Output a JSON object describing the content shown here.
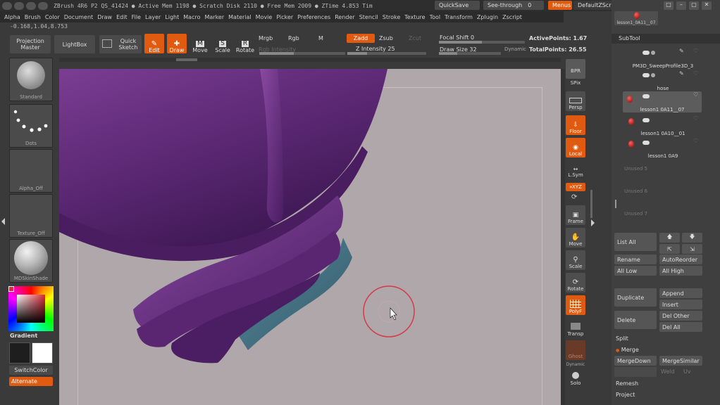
{
  "titlebar": {
    "text": "ZBrush 4R6 P2    QS_41424    ● Active Mem 1198  ● Scratch Disk 2110  ● Free Mem 2009  ● ZTime 4.853 Tim",
    "quicksave": "QuickSave",
    "seethrough_label": "See-through",
    "seethrough_value": "0",
    "menus": "Menus",
    "script": "DefaultZScript"
  },
  "menubar": [
    "Alpha",
    "Brush",
    "Color",
    "Document",
    "Draw",
    "Edit",
    "File",
    "Layer",
    "Light",
    "Macro",
    "Marker",
    "Material",
    "Movie",
    "Picker",
    "Preferences",
    "Render",
    "Stencil",
    "Stroke",
    "Texture",
    "Tool",
    "Transform",
    "Zplugin",
    "Zscript"
  ],
  "coords": "-0.168,1.04,8.753",
  "toolbar": {
    "projection_master": "Projection Master",
    "lightbox": "LightBox",
    "quick_sketch": "Quick Sketch",
    "edit": "Edit",
    "draw": "Draw",
    "move": "Move",
    "scale": "Scale",
    "rotate": "Rotate",
    "mrgb": "Mrgb",
    "rgb": "Rgb",
    "m": "M",
    "zadd": "Zadd",
    "zsub": "Zsub",
    "zcut": "Zcut",
    "rgb_intensity": "Rgb Intensity",
    "z_intensity_label": "Z Intensity",
    "z_intensity_value": "25",
    "focal_shift_label": "Focal Shift",
    "focal_shift_value": "0",
    "draw_size_label": "Draw Size",
    "draw_size_value": "32",
    "dynamic": "Dynamic",
    "active_points": "ActivePoints: 1.67",
    "total_points": "TotalPoints: 26.55"
  },
  "leftshelf": {
    "brush": "Standard",
    "stroke": "Dots",
    "alpha": "Alpha_Off",
    "texture": "Texture_Off",
    "material": "MDSkinShade",
    "gradient": "Gradient",
    "switchcolor": "SwitchColor",
    "alternate": "Alternate"
  },
  "rightshelf": {
    "bpr": "BPR",
    "spix": "SPix",
    "persp": "Persp",
    "floor": "Floor",
    "local": "Local",
    "lsym": "L.Sym",
    "xyz": "»XYZ",
    "frame": "Frame",
    "move": "Move",
    "scale": "Scale",
    "rotate": "Rotate",
    "polyf": "PolyF",
    "transp": "Transp",
    "ghost": "Ghost",
    "solo": "Solo",
    "dynamic": "Dynamic"
  },
  "panel": {
    "top_thumb_label": "lesson1_0A11__07",
    "subtool_title": "SubTool",
    "subtools": [
      "PM3D_SweepProfile3D_3",
      "hose",
      "lesson1 0A11__07",
      "lesson1 0A10__01",
      "lesson1 0A9"
    ],
    "unused": [
      "Unused 5",
      "Unused 6",
      "Unused 7"
    ],
    "list_all": "List All",
    "rename": "Rename",
    "autoreorder": "AutoReorder",
    "all_low": "All Low",
    "all_high": "All High",
    "duplicate": "Duplicate",
    "append": "Append",
    "insert": "Insert",
    "delete": "Delete",
    "del_other": "Del Other",
    "del_all": "Del All",
    "split": "Split",
    "merge": "Merge",
    "mergedown": "MergeDown",
    "mergesimilar": "MergeSimilar",
    "weld": "Weld",
    "uv": "Uv",
    "remesh": "Remesh",
    "project": "Project"
  }
}
